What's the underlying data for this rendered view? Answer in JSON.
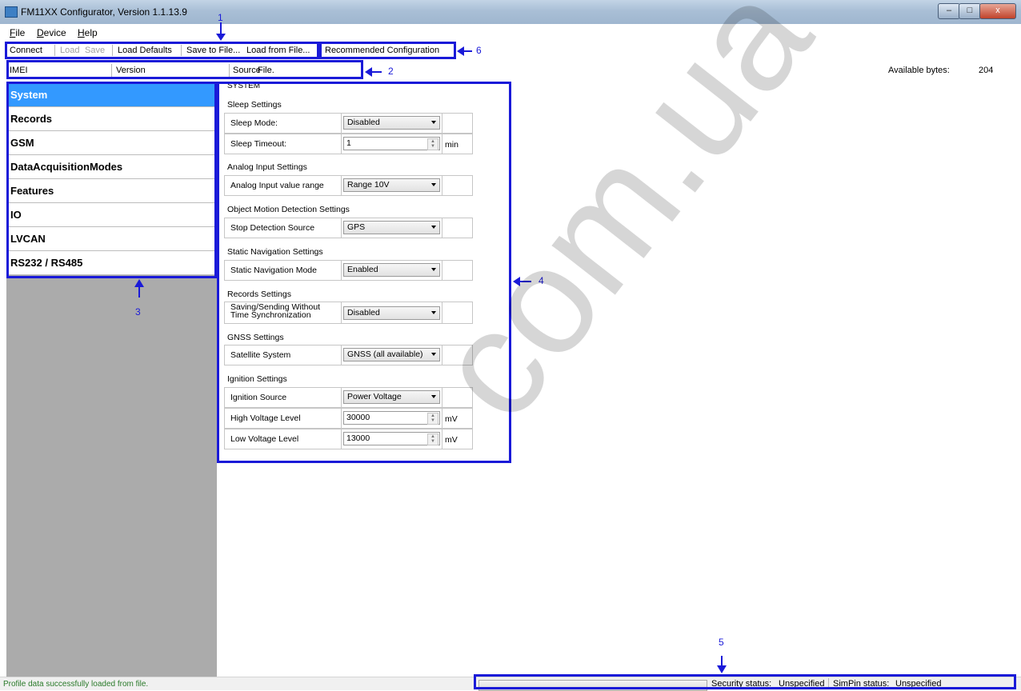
{
  "window": {
    "title": "FM11XX Configurator, Version 1.1.13.9",
    "min_glyph": "–",
    "max_glyph": "□",
    "close_glyph": "x"
  },
  "menu": [
    {
      "accel": "F",
      "rest": "ile"
    },
    {
      "accel": "D",
      "rest": "evice"
    },
    {
      "accel": "H",
      "rest": "elp"
    }
  ],
  "toolbar": {
    "connect": "Connect",
    "load": "Load",
    "save": "Save",
    "load_defaults": "Load Defaults",
    "save_to_file": "Save to File...",
    "load_from_file": "Load from File...",
    "recommended": "Recommended Configuration"
  },
  "header": {
    "imei": "IMEI",
    "version": "Version",
    "source_label": "Source",
    "source_value": "File.",
    "available_label": "Available bytes:",
    "available_value": "204"
  },
  "sidebar": {
    "items": [
      {
        "label": "System",
        "selected": true
      },
      {
        "label": "Records"
      },
      {
        "label": "GSM"
      },
      {
        "label": "DataAcquisitionModes"
      },
      {
        "label": "Features"
      },
      {
        "label": "IO"
      },
      {
        "label": "LVCAN"
      },
      {
        "label": "RS232 / RS485"
      }
    ]
  },
  "panel": {
    "title": "SYSTEM",
    "sections": {
      "sleep": "Sleep Settings",
      "analog": "Analog Input Settings",
      "motion": "Object Motion Detection Settings",
      "static": "Static Navigation Settings",
      "records": "Records Settings",
      "gnss": "GNSS Settings",
      "ignition": "Ignition Settings"
    },
    "fields": {
      "sleep_mode": {
        "label": "Sleep Mode:",
        "value": "Disabled"
      },
      "sleep_timeout": {
        "label": "Sleep Timeout:",
        "value": "1",
        "unit": "min"
      },
      "analog_range": {
        "label": "Analog Input value range",
        "value": "Range 10V"
      },
      "stop_detection": {
        "label": "Stop Detection Source",
        "value": "GPS"
      },
      "static_nav": {
        "label": "Static Navigation Mode",
        "value": "Enabled"
      },
      "saving_line1": "Saving/Sending Without",
      "saving_line2": "Time Synchronization",
      "saving_value": "Disabled",
      "satellite": {
        "label": "Satellite System",
        "value": "GNSS (all available)"
      },
      "ignition_source": {
        "label": "Ignition Source",
        "value": "Power Voltage"
      },
      "high_voltage": {
        "label": "High Voltage Level",
        "value": "30000",
        "unit": "mV"
      },
      "low_voltage": {
        "label": "Low Voltage Level",
        "value": "13000",
        "unit": "mV"
      }
    }
  },
  "statusbar": {
    "message": "Profile data successfully loaded from file.",
    "security_label": "Security status:",
    "security_value": "Unspecified",
    "simpin_label": "SimPin status:",
    "simpin_value": "Unspecified"
  },
  "annotations": {
    "n1": "1",
    "n2": "2",
    "n3": "3",
    "n4": "4",
    "n5": "5",
    "n6": "6",
    "color": "#1a1ad8"
  },
  "watermark": "com.ua"
}
